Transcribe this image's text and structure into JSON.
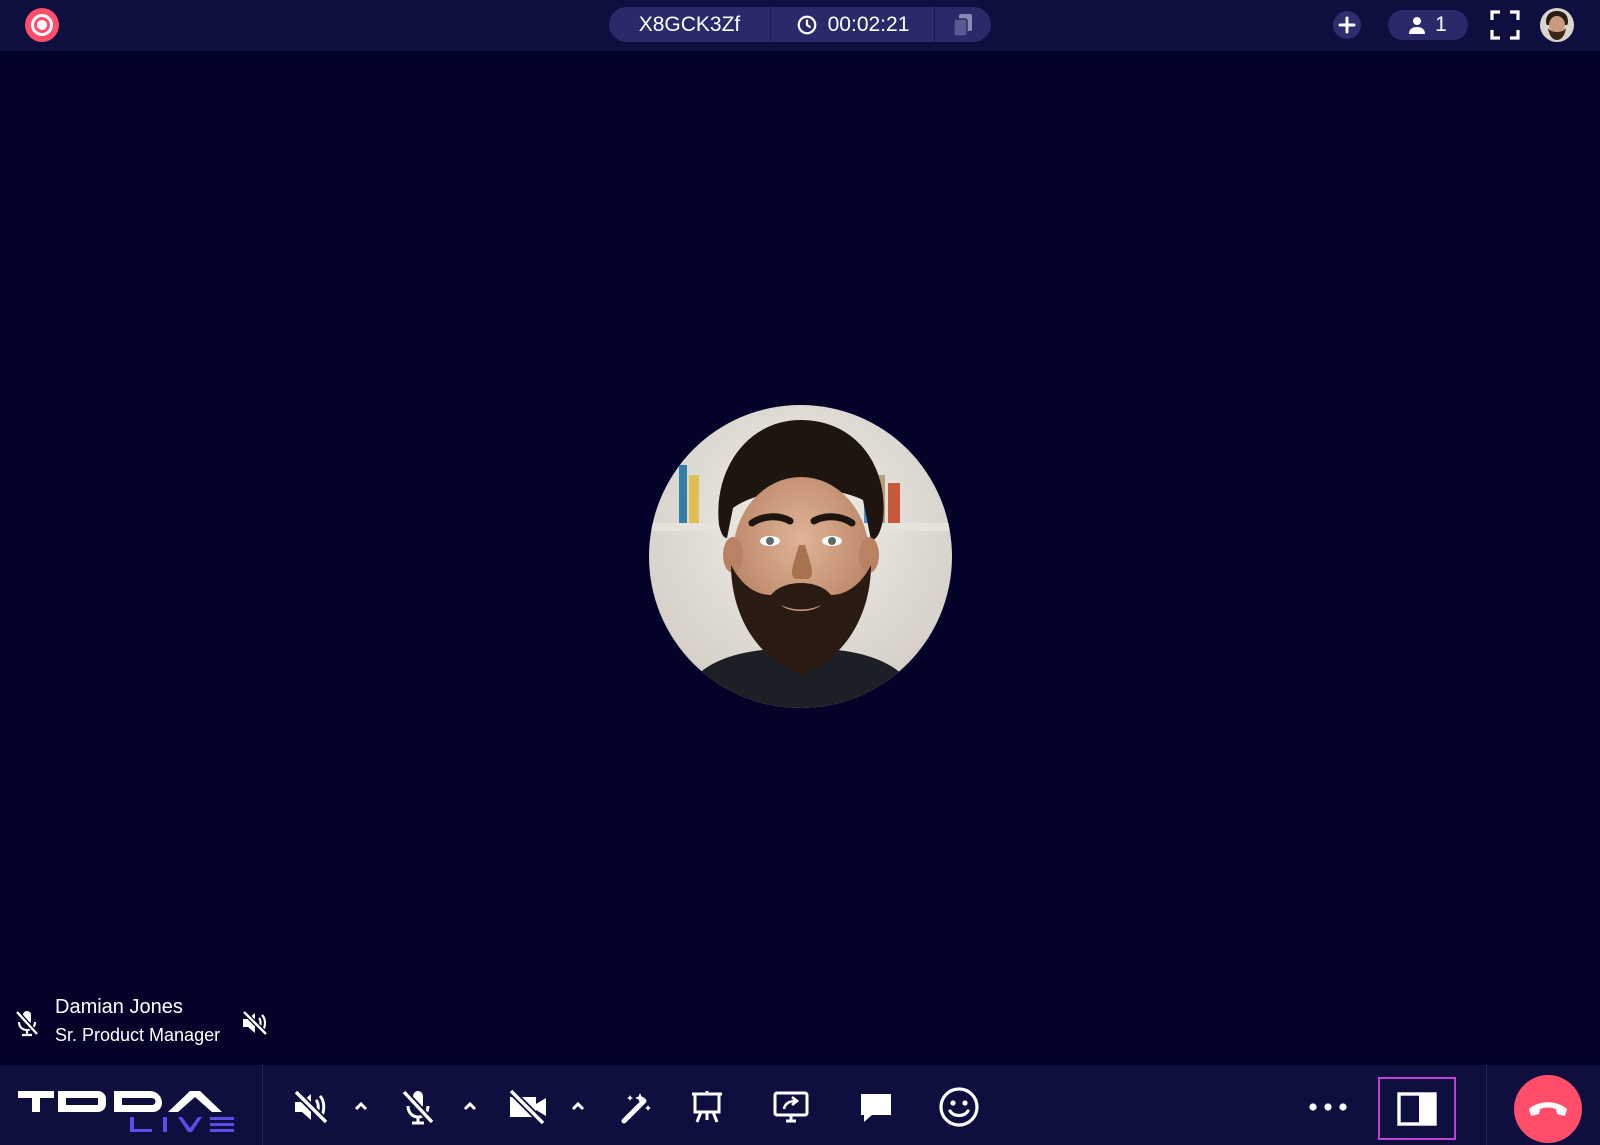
{
  "topbar": {
    "meeting_code": "X8GCK3Zf",
    "elapsed_time": "00:02:21",
    "participant_count": "1"
  },
  "participant": {
    "name": "Damian Jones",
    "title": "Sr. Product Manager"
  },
  "brand": {
    "logo_top": "TODA",
    "logo_bottom": "LIVE"
  },
  "colors": {
    "background": "#03032a",
    "bar": "#0e0e3f",
    "pill": "#2a2a6a",
    "accent_red": "#ff4d6a",
    "layout_highlight": "#c23fd9",
    "logo_live": "#6a4df0"
  },
  "icons": {
    "record": "record-icon",
    "clock": "clock-icon",
    "copy": "copy-icon",
    "add": "plus-icon",
    "person": "person-icon",
    "fullscreen": "fullscreen-icon",
    "speaker_muted": "speaker-muted-icon",
    "mic_muted": "mic-muted-icon",
    "camera_off": "camera-off-icon",
    "effects": "magic-wand-icon",
    "whiteboard": "presentation-board-icon",
    "screen_share": "screen-share-icon",
    "chat": "chat-bubble-icon",
    "reactions": "smiley-icon",
    "more": "more-dots-icon",
    "layout": "layout-sidebar-icon",
    "hangup": "phone-hangup-icon"
  }
}
